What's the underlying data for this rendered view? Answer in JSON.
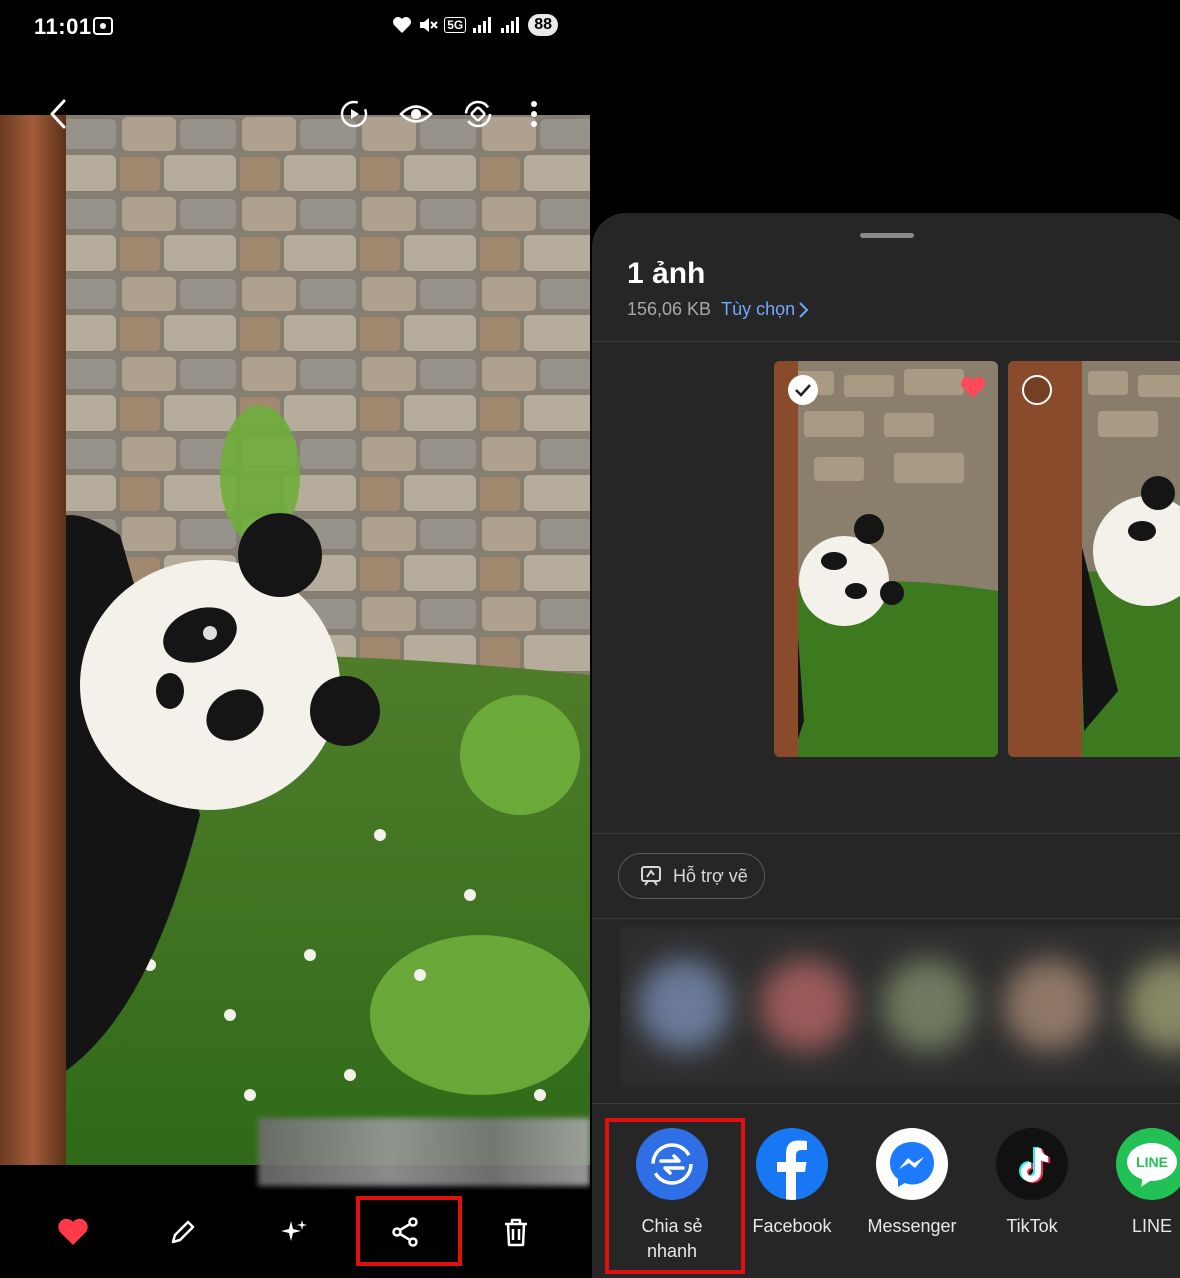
{
  "status_bar": {
    "time": "11:01",
    "battery": "88",
    "network_label": "5G"
  },
  "viewer": {
    "topbar_icons": [
      "back-icon",
      "remaster-video-icon",
      "eye-icon",
      "rotate-icon",
      "more-vert-icon"
    ],
    "bottom_actions": [
      {
        "name": "favorite-icon",
        "color": "#ff3b4a"
      },
      {
        "name": "edit-icon"
      },
      {
        "name": "ai-effects-icon"
      },
      {
        "name": "share-icon",
        "highlighted": true
      },
      {
        "name": "delete-icon"
      }
    ]
  },
  "share_sheet": {
    "title": "1 ảnh",
    "size": "156,06 KB",
    "options_link": "Tùy chọn",
    "chip_label": "Hỗ trợ vẽ",
    "thumbnails": [
      {
        "selected": true,
        "favorite": true
      },
      {
        "selected": false,
        "favorite": false
      }
    ],
    "apps": [
      {
        "label": "Chia sẻ nhanh",
        "label_line1": "Chia sẻ",
        "label_line2": "nhanh",
        "icon": "quick-share-icon",
        "color": "#2f6fe6",
        "highlighted": true
      },
      {
        "label": "Facebook",
        "icon": "facebook-icon",
        "color": "#1877f2"
      },
      {
        "label": "Messenger",
        "icon": "messenger-icon",
        "color": "#ffffff"
      },
      {
        "label": "TikTok",
        "icon": "tiktok-icon",
        "color": "#111111"
      },
      {
        "label": "LINE",
        "icon": "line-icon",
        "color": "#22c155"
      }
    ]
  },
  "colors": {
    "accent_link": "#6fa8ff",
    "highlight_box": "#e01010",
    "sheet_background": "#262626"
  }
}
